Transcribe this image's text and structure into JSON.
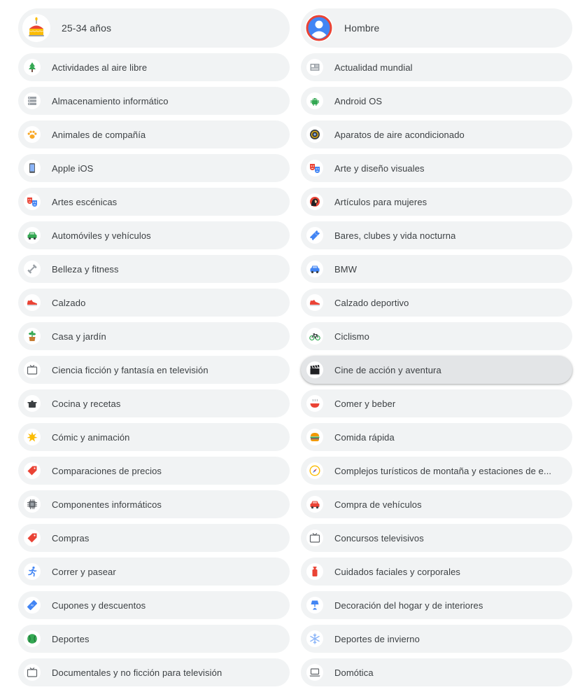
{
  "left_column": [
    {
      "name": "age-chip",
      "label": "25-34 años",
      "icon": "cake-icon",
      "big": true
    },
    {
      "name": "interest-outdoor",
      "label": "Actividades al aire libre",
      "icon": "tree-icon"
    },
    {
      "name": "interest-storage",
      "label": "Almacenamiento informático",
      "icon": "storage-icon"
    },
    {
      "name": "interest-pets",
      "label": "Animales de compañía",
      "icon": "paw-icon"
    },
    {
      "name": "interest-ios",
      "label": "Apple iOS",
      "icon": "smartphone-icon"
    },
    {
      "name": "interest-performing-arts",
      "label": "Artes escénicas",
      "icon": "theater-masks-icon"
    },
    {
      "name": "interest-autos",
      "label": "Automóviles y vehículos",
      "icon": "green-car-icon"
    },
    {
      "name": "interest-fitness",
      "label": "Belleza y fitness",
      "icon": "dumbbell-icon"
    },
    {
      "name": "interest-footwear",
      "label": "Calzado",
      "icon": "sneaker-icon"
    },
    {
      "name": "interest-home-garden",
      "label": "Casa y jardín",
      "icon": "potted-plant-icon"
    },
    {
      "name": "interest-scifi-tv",
      "label": "Ciencia ficción y fantasía en televisión",
      "icon": "tv-icon"
    },
    {
      "name": "interest-cooking",
      "label": "Cocina y recetas",
      "icon": "cooking-pot-icon"
    },
    {
      "name": "interest-comics",
      "label": "Cómic y animación",
      "icon": "starburst-icon"
    },
    {
      "name": "interest-price-comparison",
      "label": "Comparaciones de precios",
      "icon": "price-tag-icon"
    },
    {
      "name": "interest-components",
      "label": "Componentes informáticos",
      "icon": "chip-icon"
    },
    {
      "name": "interest-shopping",
      "label": "Compras",
      "icon": "price-tag-icon"
    },
    {
      "name": "interest-running",
      "label": "Correr y pasear",
      "icon": "running-person-icon"
    },
    {
      "name": "interest-coupons",
      "label": "Cupones y descuentos",
      "icon": "coupon-icon"
    },
    {
      "name": "interest-sports",
      "label": "Deportes",
      "icon": "ball-icon"
    },
    {
      "name": "interest-documentaries",
      "label": "Documentales y no ficción para televisión",
      "icon": "tv-icon"
    }
  ],
  "right_column": [
    {
      "name": "gender-chip",
      "label": "Hombre",
      "icon": "person-avatar-icon",
      "big": true
    },
    {
      "name": "interest-world-news",
      "label": "Actualidad mundial",
      "icon": "newspaper-icon"
    },
    {
      "name": "interest-android",
      "label": "Android OS",
      "icon": "android-icon"
    },
    {
      "name": "interest-air-conditioning",
      "label": "Aparatos de aire acondicionado",
      "icon": "air-conditioner-icon"
    },
    {
      "name": "interest-visual-arts",
      "label": "Arte y diseño visuales",
      "icon": "theater-masks-icon"
    },
    {
      "name": "interest-womens-items",
      "label": "Artículos para mujeres",
      "icon": "woman-profile-icon"
    },
    {
      "name": "interest-nightlife",
      "label": "Bares, clubes y vida nocturna",
      "icon": "ticket-icon"
    },
    {
      "name": "interest-bmw",
      "label": "BMW",
      "icon": "blue-car-icon"
    },
    {
      "name": "interest-athletic-footwear",
      "label": "Calzado deportivo",
      "icon": "sneaker-icon"
    },
    {
      "name": "interest-cycling",
      "label": "Ciclismo",
      "icon": "bicycle-icon"
    },
    {
      "name": "interest-action-movies",
      "label": "Cine de acción y aventura",
      "icon": "clapperboard-icon",
      "highlighted": true
    },
    {
      "name": "interest-food-drink",
      "label": "Comer y beber",
      "icon": "soup-bowl-icon"
    },
    {
      "name": "interest-fast-food",
      "label": "Comida rápida",
      "icon": "burger-icon"
    },
    {
      "name": "interest-ski-resorts",
      "label": "Complejos turísticos de montaña y estaciones de e...",
      "icon": "compass-icon"
    },
    {
      "name": "interest-vehicle-shopping",
      "label": "Compra de vehículos",
      "icon": "red-car-icon"
    },
    {
      "name": "interest-game-shows",
      "label": "Concursos televisivos",
      "icon": "tv-icon"
    },
    {
      "name": "interest-skin-care",
      "label": "Cuidados faciales y corporales",
      "icon": "lotion-bottle-icon"
    },
    {
      "name": "interest-home-decor",
      "label": "Decoración del hogar y de interiores",
      "icon": "lamp-icon"
    },
    {
      "name": "interest-winter-sports",
      "label": "Deportes de invierno",
      "icon": "snowflake-icon"
    },
    {
      "name": "interest-home-automation",
      "label": "Domótica",
      "icon": "laptop-icon"
    }
  ]
}
